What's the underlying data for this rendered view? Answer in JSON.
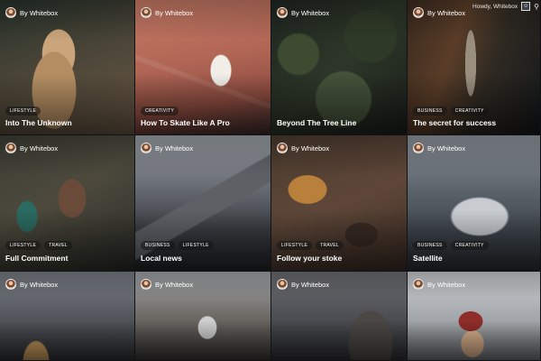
{
  "admin_bar": {
    "greeting": "Howdy, Whitebox",
    "search_icon": "search-icon",
    "avatar_icon": "user-avatar-icon"
  },
  "posts": [
    {
      "author": "By Whitebox",
      "tags": [
        "LIFESTYLE"
      ],
      "title": "Into The Unknown"
    },
    {
      "author": "By Whitebox",
      "tags": [
        "CREATIVITY"
      ],
      "title": "How To Skate Like A Pro"
    },
    {
      "author": "By Whitebox",
      "tags": [],
      "title": "Beyond The Tree Line"
    },
    {
      "author": "By Whitebox",
      "tags": [
        "BUSINESS",
        "CREATIVITY"
      ],
      "title": "The secret for success"
    },
    {
      "author": "By Whitebox",
      "tags": [
        "LIFESTYLE",
        "TRAVEL"
      ],
      "title": "Full Commitment"
    },
    {
      "author": "By Whitebox",
      "tags": [
        "BUSINESS",
        "LIFESTYLE"
      ],
      "title": "Local news"
    },
    {
      "author": "By Whitebox",
      "tags": [
        "LIFESTYLE",
        "TRAVEL"
      ],
      "title": "Follow your stoke"
    },
    {
      "author": "By Whitebox",
      "tags": [
        "BUSINESS",
        "CREATIVITY"
      ],
      "title": "Satellite"
    },
    {
      "author": "By Whitebox",
      "tags": [],
      "title": ""
    },
    {
      "author": "By Whitebox",
      "tags": [],
      "title": ""
    },
    {
      "author": "By Whitebox",
      "tags": [],
      "title": ""
    },
    {
      "author": "By Whitebox",
      "tags": [],
      "title": ""
    }
  ]
}
